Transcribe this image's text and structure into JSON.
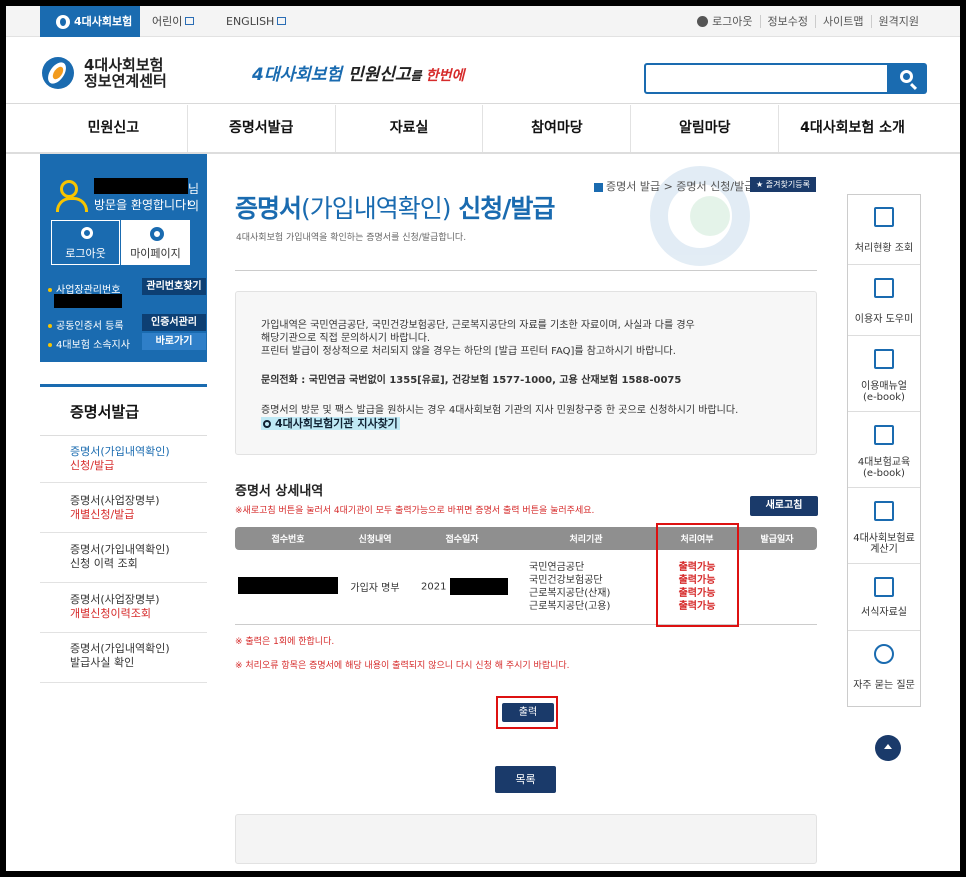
{
  "topbar": {
    "active_tab": "4대사회보험",
    "tab_kids": "어린이",
    "tab_english": "ENGLISH",
    "logout": "로그아웃",
    "edit_info": "정보수정",
    "sitemap": "사이트맵",
    "remote": "원격지원"
  },
  "header": {
    "brand_line1": "4대사회보험",
    "brand_line2": "정보연계센터",
    "slogan_blue": "4대사회보험",
    "slogan_mid": " 민원신고",
    "slogan_small": "를 ",
    "slogan_red": "한번에",
    "search_placeholder": ""
  },
  "gnb": [
    "민원신고",
    "증명서발급",
    "자료실",
    "참여마당",
    "알림마당",
    "4대사회보험 소개"
  ],
  "user": {
    "nim": "님의",
    "welcome": "방문을 환영합니다!",
    "logout": "로그아웃",
    "mypage": "마이페이지",
    "biz_no_label": "사업장관리번호",
    "find_no": "관리번호찾기",
    "cert_reg": "공동인증서 등록",
    "cert_manage": "인증서관리",
    "branch": "4대보험 소속지사",
    "go": "바로가기"
  },
  "lmenu": {
    "title": "증명서발급",
    "items": [
      {
        "line1": "증명서(가입내역확인)",
        "line2": "신청/발급"
      },
      {
        "line1": "증명서(사업장명부)",
        "line2": "개별신청/발급"
      },
      {
        "line1": "증명서(가입내역확인)",
        "line2": "신청 이력 조회"
      },
      {
        "line1": "증명서(사업장명부)",
        "line2": "개별신청이력조회"
      },
      {
        "line1": "증명서(가입내역확인)",
        "line2": "발급사실 확인"
      }
    ]
  },
  "content": {
    "crumb": "증명서 발급 > 증명서 신청/발급",
    "fav": "즐겨찾기등록",
    "title_bold1": "증명서",
    "title_light": "(가입내역확인)",
    "title_bold2": " 신청/발급",
    "desc": "4대사회보험 가입내역을 확인하는 증명서를 신청/발급합니다.",
    "info1": "가입내역은 국민연금공단, 국민건강보험공단, 근로복지공단의 자료를 기초한 자료이며, 사실과 다를 경우",
    "info2": "해당기관으로 직접 문의하시기 바랍니다.",
    "info3": "프린터 발급이 정상적으로 처리되지 않을 경우는 하단의 [발급 프린터 FAQ]를 참고하시기 바랍니다.",
    "tel": "문의전화 : 국민연금 국번없이 1355[유료], 건강보험 1577-1000, 고용 산재보험 1588-0075",
    "visit": "증명서의 방문 및 팩스 발급을 원하시는 경우 4대사회보험 기관의 지사 민원창구중 한 곳으로 신청하시기 바랍니다.",
    "branch_link": "4대사회보험기관 지사찾기",
    "section_title": "증명서 상세내역",
    "refresh_note": "※새로고침 버튼을 눌러서 4대기관이 모두 출력가능으로 바뀌면 증명서 출력 버튼을 눌러주세요.",
    "refresh_btn": "새로고침",
    "table": {
      "headers": [
        "접수번호",
        "신청내역",
        "접수일자",
        "처리기관",
        "처리여부",
        "발급일자"
      ],
      "row": {
        "type": "가입자 명부",
        "date_prefix": "2021",
        "orgs": [
          "국민연금공단",
          "국민건강보험공단",
          "근로복지공단(산재)",
          "근로복지공단(고용)"
        ],
        "status": [
          "출력가능",
          "출력가능",
          "출력가능",
          "출력가능"
        ]
      }
    },
    "note1": "※ 출력은 1회에 한합니다.",
    "note2": "※ 처리오류 항목은 증명서에 해당 내용이 출력되지 않으니 다시 신청 해 주시기 바랍니다.",
    "print_btn": "출력",
    "list_btn": "목록"
  },
  "quick": [
    {
      "line1": "처리현황 조회",
      "line2": ""
    },
    {
      "line1": "이용자 도우미",
      "line2": ""
    },
    {
      "line1": "이용매뉴얼",
      "line2": "(e-book)"
    },
    {
      "line1": "4대보험교육",
      "line2": "(e-book)"
    },
    {
      "line1": "4대사회보험료",
      "line2": "계산기"
    },
    {
      "line1": "서식자료실",
      "line2": ""
    },
    {
      "line1": "자주 묻는 질문",
      "line2": ""
    }
  ],
  "colors": {
    "brand": "#1a6bb0",
    "dark": "#1a3a6a",
    "alert": "#d62b2b",
    "highlight_box": "#dd1111"
  }
}
